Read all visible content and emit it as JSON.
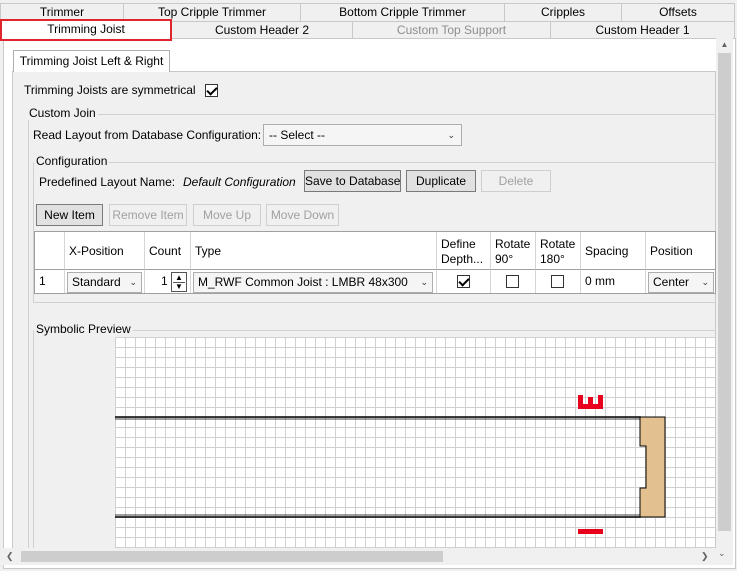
{
  "tabs_row1": [
    {
      "label": "Trimmer"
    },
    {
      "label": "Top Cripple Trimmer"
    },
    {
      "label": "Bottom Cripple Trimmer"
    },
    {
      "label": "Cripples"
    },
    {
      "label": "Offsets"
    }
  ],
  "tabs_row2": [
    {
      "label": "Trimming Joist",
      "state": "active"
    },
    {
      "label": "Custom Header 2"
    },
    {
      "label": "Custom Top Support",
      "state": "disabled"
    },
    {
      "label": "Custom Header 1"
    }
  ],
  "subtab": {
    "label": "Trimming Joist Left & Right"
  },
  "symmetry": {
    "label": "Trimming Joists  are symmetrical",
    "checked": true
  },
  "custom_join": {
    "title": "Custom Join",
    "read_layout_label": "Read Layout from Database Configuration:",
    "read_layout_value": "-- Select --"
  },
  "configuration": {
    "title": "Configuration",
    "predefined_label": "Predefined Layout Name:",
    "predefined_value": "Default Configuration",
    "save_button": "Save to Database",
    "duplicate_button": "Duplicate",
    "delete_button": "Delete"
  },
  "row_actions": {
    "new_item": "New Item",
    "remove_item": "Remove Item",
    "move_up": "Move Up",
    "move_down": "Move Down"
  },
  "table": {
    "headers": {
      "x_position": "X-Position",
      "count": "Count",
      "type": "Type",
      "define_depth": "Define Depth...",
      "rotate90": "Rotate 90°",
      "rotate180": "Rotate 180°",
      "spacing": "Spacing",
      "position": "Position"
    },
    "rows": [
      {
        "index": "1",
        "x_position": "Standard",
        "count": "1",
        "type": "M_RWF Common Joist : LMBR 48x300",
        "define_depth": true,
        "rotate90": false,
        "rotate180": false,
        "spacing": "0 mm",
        "position": "Center"
      }
    ]
  },
  "preview": {
    "title": "Symbolic Preview",
    "marker_color": "#e8001c",
    "joist_color": "#e3c08f"
  },
  "colors": {
    "active_tab_border": "#e0252b"
  }
}
